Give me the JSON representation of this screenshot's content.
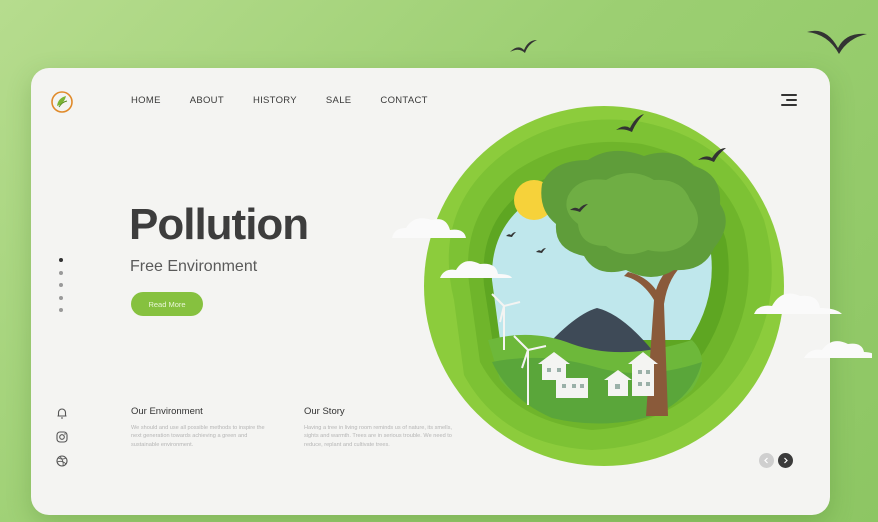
{
  "nav": {
    "items": [
      "HOME",
      "ABOUT",
      "HISTORY",
      "SALE",
      "CONTACT"
    ]
  },
  "hero": {
    "title": "Pollution",
    "subtitle": "Free Environment",
    "cta_label": "Read More"
  },
  "slider": {
    "dot_count": 5,
    "active_index": 0
  },
  "sections": [
    {
      "heading": "Our Environment",
      "text": "We should and use all possible methods to inspire the next generation towards achieving a green and sustainable environment."
    },
    {
      "heading": "Our Story",
      "text": "Having a tree in living room reminds us of nature, its smells, sights and warmth. Trees are in serious trouble. We need to reduce, replant and cultivate trees."
    }
  ],
  "social_icons": [
    "bell-icon",
    "instagram-icon",
    "dribbble-icon"
  ],
  "colors": {
    "background": "#9ccf72",
    "accent": "#86c13f",
    "card": "#f4f4f2",
    "title": "#3d3d3d"
  }
}
